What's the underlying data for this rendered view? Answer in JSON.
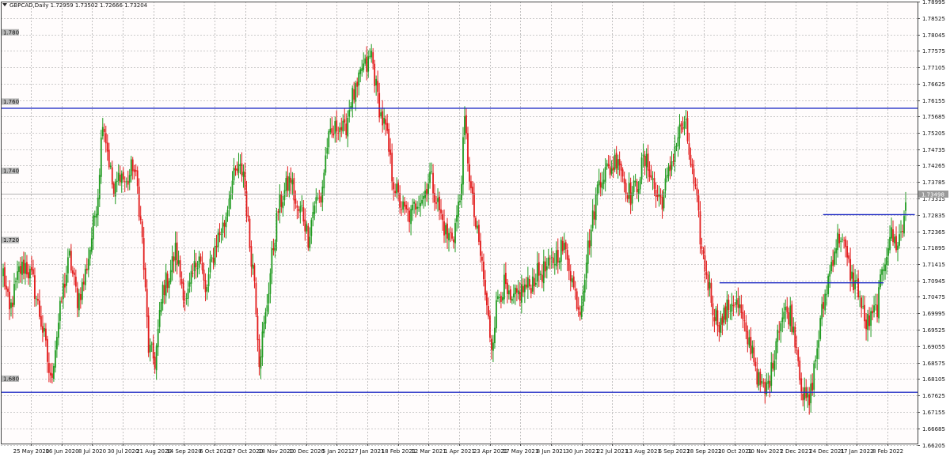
{
  "chart_data": {
    "type": "candlestick",
    "symbol_label": "GBPCAD,Daily",
    "ohlc_label": "1.72959 1.73502 1.72666 1.73204",
    "colors": {
      "background": "#fffcfc",
      "grid": "#9a9a9a",
      "up": "#1f9a1f",
      "down": "#e21b1b",
      "level_line": "#1f2bc4",
      "current_price_line": "#9a9a9a",
      "axis_text": "#111111"
    },
    "ylim": [
      1.6624,
      1.79
    ],
    "grid": true,
    "right_axis_ticks": [
      "1.78995",
      "1.78525",
      "1.78045",
      "1.77575",
      "1.77105",
      "1.76625",
      "1.76155",
      "1.75685",
      "1.75205",
      "1.74735",
      "1.74265",
      "1.73785",
      "1.73315",
      "1.72835",
      "1.72365",
      "1.71895",
      "1.71415",
      "1.70945",
      "1.70475",
      "1.69995",
      "1.69525",
      "1.69055",
      "1.68575",
      "1.68105",
      "1.67625",
      "1.67155",
      "1.66685",
      "1.66205"
    ],
    "left_level_labels": [
      {
        "text": "1.780",
        "value": 1.78
      },
      {
        "text": "1.760",
        "value": 1.76
      },
      {
        "text": "1.740",
        "value": 1.74
      },
      {
        "text": "1.720",
        "value": 1.72
      },
      {
        "text": "1.680",
        "value": 1.68
      }
    ],
    "current_price": {
      "text": "1.73498",
      "value": 1.7345
    },
    "x_labels": [
      "25 May 2020",
      "16 Jun 2020",
      "8 Jul 2020",
      "30 Jul 2020",
      "21 Aug 2020",
      "14 Sep 2020",
      "6 Oct 2020",
      "27 Oct 2020",
      "18 Nov 2020",
      "10 Dec 2020",
      "5 Jan 2021",
      "27 Jan 2021",
      "18 Feb 2021",
      "12 Mar 2021",
      "1 Apr 2021",
      "23 Apr 2021",
      "17 May 2021",
      "8 Jun 2021",
      "30 Jun 2021",
      "22 Jul 2021",
      "13 Aug 2021",
      "6 Sep 2021",
      "28 Sep 2021",
      "20 Oct 2021",
      "10 Nov 2021",
      "2 Dec 2021",
      "24 Dec 2021",
      "17 Jan 2022",
      "8 Feb 2022"
    ],
    "horizontal_levels": [
      {
        "value": 1.7592,
        "from_frac": 0.0,
        "to_frac": 1.0
      },
      {
        "value": 1.6772,
        "from_frac": 0.0,
        "to_frac": 1.0
      },
      {
        "value": 1.7088,
        "from_frac": 0.784,
        "to_frac": 0.963
      },
      {
        "value": 1.7285,
        "from_frac": 0.897,
        "to_frac": 0.997
      }
    ],
    "anchors": [
      [
        0,
        1.712
      ],
      [
        4,
        1.7
      ],
      [
        10,
        1.712
      ],
      [
        14,
        1.714
      ],
      [
        19,
        1.709
      ],
      [
        26,
        1.693
      ],
      [
        30,
        1.68
      ],
      [
        34,
        1.694
      ],
      [
        38,
        1.707
      ],
      [
        42,
        1.716
      ],
      [
        47,
        1.704
      ],
      [
        51,
        1.709
      ],
      [
        55,
        1.719
      ],
      [
        60,
        1.735
      ],
      [
        63,
        1.757
      ],
      [
        67,
        1.744
      ],
      [
        70,
        1.734
      ],
      [
        74,
        1.741
      ],
      [
        78,
        1.737
      ],
      [
        82,
        1.743
      ],
      [
        85,
        1.736
      ],
      [
        88,
        1.721
      ],
      [
        92,
        1.69
      ],
      [
        96,
        1.686
      ],
      [
        101,
        1.707
      ],
      [
        105,
        1.711
      ],
      [
        109,
        1.718
      ],
      [
        112,
        1.711
      ],
      [
        116,
        1.703
      ],
      [
        120,
        1.711
      ],
      [
        124,
        1.718
      ],
      [
        128,
        1.705
      ],
      [
        131,
        1.713
      ],
      [
        135,
        1.721
      ],
      [
        140,
        1.726
      ],
      [
        144,
        1.737
      ],
      [
        148,
        1.741
      ],
      [
        152,
        1.741
      ],
      [
        156,
        1.72
      ],
      [
        159,
        1.71
      ],
      [
        162,
        1.687
      ],
      [
        166,
        1.699
      ],
      [
        170,
        1.716
      ],
      [
        174,
        1.73
      ],
      [
        178,
        1.735
      ],
      [
        182,
        1.739
      ],
      [
        186,
        1.729
      ],
      [
        189,
        1.73
      ],
      [
        193,
        1.722
      ],
      [
        197,
        1.732
      ],
      [
        201,
        1.733
      ],
      [
        205,
        1.749
      ],
      [
        209,
        1.752
      ],
      [
        212,
        1.755
      ],
      [
        216,
        1.752
      ],
      [
        220,
        1.762
      ],
      [
        224,
        1.764
      ],
      [
        227,
        1.771
      ],
      [
        230,
        1.771
      ],
      [
        233,
        1.775
      ],
      [
        236,
        1.765
      ],
      [
        239,
        1.757
      ],
      [
        242,
        1.753
      ],
      [
        246,
        1.74
      ],
      [
        250,
        1.733
      ],
      [
        254,
        1.729
      ],
      [
        258,
        1.728
      ],
      [
        262,
        1.733
      ],
      [
        266,
        1.734
      ],
      [
        270,
        1.74
      ],
      [
        273,
        1.735
      ],
      [
        277,
        1.728
      ],
      [
        281,
        1.722
      ],
      [
        285,
        1.723
      ],
      [
        289,
        1.733
      ],
      [
        292,
        1.755
      ],
      [
        296,
        1.735
      ],
      [
        299,
        1.725
      ],
      [
        303,
        1.714
      ],
      [
        306,
        1.701
      ],
      [
        309,
        1.691
      ],
      [
        313,
        1.705
      ],
      [
        317,
        1.708
      ],
      [
        321,
        1.702
      ],
      [
        325,
        1.705
      ],
      [
        329,
        1.707
      ],
      [
        333,
        1.708
      ],
      [
        337,
        1.711
      ],
      [
        341,
        1.712
      ],
      [
        345,
        1.713
      ],
      [
        349,
        1.716
      ],
      [
        353,
        1.719
      ],
      [
        357,
        1.717
      ],
      [
        361,
        1.707
      ],
      [
        365,
        1.701
      ],
      [
        369,
        1.716
      ],
      [
        373,
        1.727
      ],
      [
        377,
        1.739
      ],
      [
        381,
        1.741
      ],
      [
        385,
        1.742
      ],
      [
        389,
        1.746
      ],
      [
        393,
        1.738
      ],
      [
        397,
        1.734
      ],
      [
        401,
        1.737
      ],
      [
        405,
        1.744
      ],
      [
        409,
        1.742
      ],
      [
        413,
        1.734
      ],
      [
        417,
        1.733
      ],
      [
        421,
        1.74
      ],
      [
        425,
        1.748
      ],
      [
        429,
        1.754
      ],
      [
        432,
        1.753
      ],
      [
        436,
        1.74
      ],
      [
        439,
        1.731
      ],
      [
        442,
        1.718
      ],
      [
        446,
        1.709
      ],
      [
        450,
        1.7
      ],
      [
        454,
        1.697
      ],
      [
        458,
        1.701
      ],
      [
        462,
        1.704
      ],
      [
        466,
        1.701
      ],
      [
        470,
        1.693
      ],
      [
        474,
        1.69
      ],
      [
        478,
        1.68
      ],
      [
        482,
        1.677
      ],
      [
        486,
        1.683
      ],
      [
        490,
        1.696
      ],
      [
        494,
        1.7
      ],
      [
        498,
        1.7
      ],
      [
        502,
        1.691
      ],
      [
        506,
        1.676
      ],
      [
        510,
        1.674
      ],
      [
        514,
        1.687
      ],
      [
        518,
        1.7
      ],
      [
        522,
        1.71
      ],
      [
        526,
        1.719
      ],
      [
        530,
        1.723
      ],
      [
        533,
        1.717
      ],
      [
        537,
        1.71
      ],
      [
        541,
        1.707
      ],
      [
        545,
        1.697
      ],
      [
        549,
        1.698
      ],
      [
        553,
        1.702
      ],
      [
        557,
        1.714
      ],
      [
        561,
        1.723
      ],
      [
        565,
        1.72
      ],
      [
        569,
        1.724
      ],
      [
        571,
        1.733
      ]
    ]
  }
}
